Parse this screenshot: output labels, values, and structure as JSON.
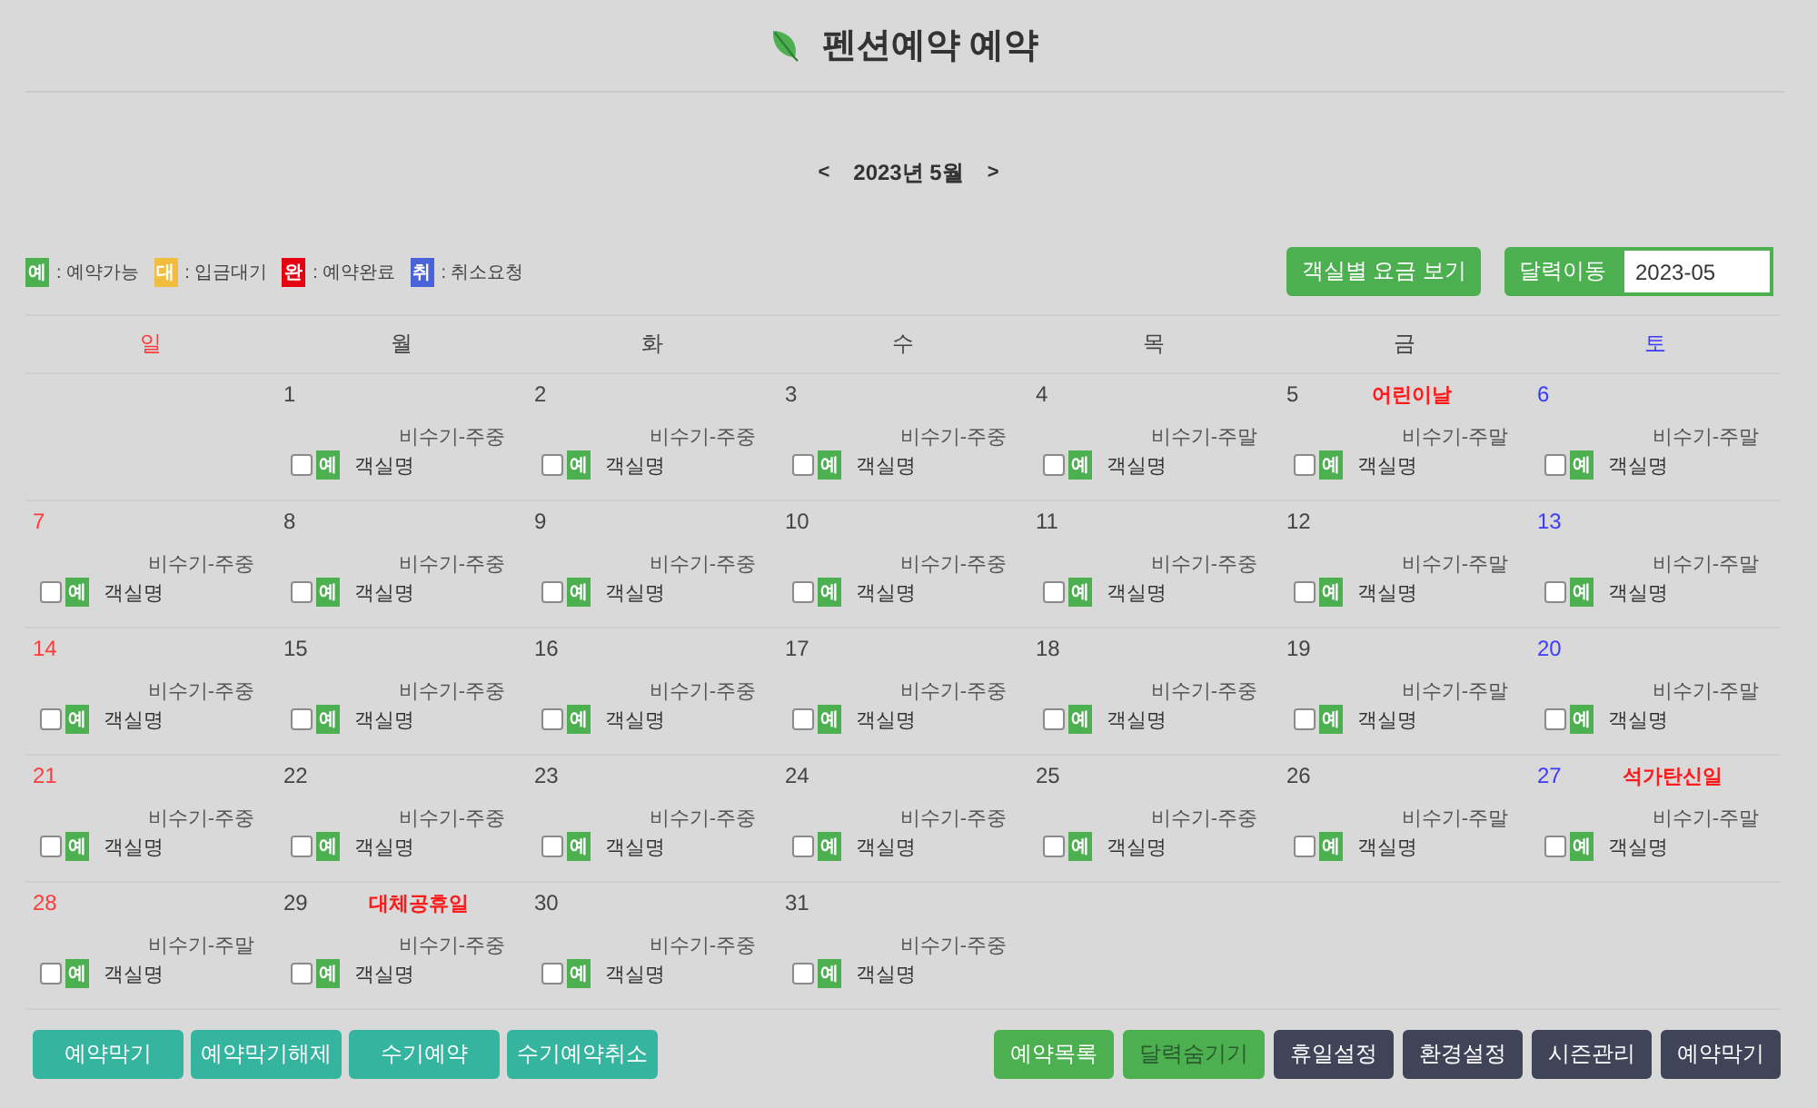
{
  "header": {
    "title": "펜션예약 예약"
  },
  "month_nav": {
    "prev": "<",
    "label": "2023년 5월",
    "next": ">"
  },
  "legend": [
    {
      "badge": "예",
      "label": ": 예약가능",
      "color": "#4caf50"
    },
    {
      "badge": "대",
      "label": ": 입금대기",
      "color": "#f0bd3f"
    },
    {
      "badge": "완",
      "label": ": 예약완료",
      "color": "#e60012"
    },
    {
      "badge": "취",
      "label": ": 취소요청",
      "color": "#4a63d8"
    }
  ],
  "toolbar": {
    "rate_button": "객실별 요금 보기",
    "date_jump": {
      "button": "달력이동",
      "value": "2023-05"
    }
  },
  "calendar": {
    "weekdays": [
      {
        "label": "일",
        "kind": "sunday"
      },
      {
        "label": "월",
        "kind": "weekday"
      },
      {
        "label": "화",
        "kind": "weekday"
      },
      {
        "label": "수",
        "kind": "weekday"
      },
      {
        "label": "목",
        "kind": "weekday"
      },
      {
        "label": "금",
        "kind": "weekday"
      },
      {
        "label": "토",
        "kind": "saturday"
      }
    ],
    "weeks": [
      [
        {
          "kind": "blank"
        },
        {
          "kind": "weekday",
          "date": "1",
          "season": "비수기-주중",
          "rooms": [
            {
              "checked": false,
              "badge": "예",
              "color": "#4caf50",
              "name": "객실명"
            }
          ]
        },
        {
          "kind": "weekday",
          "date": "2",
          "season": "비수기-주중",
          "rooms": [
            {
              "checked": false,
              "badge": "예",
              "color": "#4caf50",
              "name": "객실명"
            }
          ]
        },
        {
          "kind": "weekday",
          "date": "3",
          "season": "비수기-주중",
          "rooms": [
            {
              "checked": false,
              "badge": "예",
              "color": "#4caf50",
              "name": "객실명"
            }
          ]
        },
        {
          "kind": "weekday",
          "date": "4",
          "season": "비수기-주말",
          "rooms": [
            {
              "checked": false,
              "badge": "예",
              "color": "#4caf50",
              "name": "객실명"
            }
          ]
        },
        {
          "kind": "weekday",
          "date": "5",
          "holiday": "어린이날",
          "season": "비수기-주말",
          "rooms": [
            {
              "checked": false,
              "badge": "예",
              "color": "#4caf50",
              "name": "객실명"
            }
          ]
        },
        {
          "kind": "saturday",
          "date": "6",
          "season": "비수기-주말",
          "rooms": [
            {
              "checked": false,
              "badge": "예",
              "color": "#4caf50",
              "name": "객실명"
            }
          ]
        }
      ],
      [
        {
          "kind": "sunday",
          "date": "7",
          "season": "비수기-주중",
          "rooms": [
            {
              "checked": false,
              "badge": "예",
              "color": "#4caf50",
              "name": "객실명"
            }
          ]
        },
        {
          "kind": "weekday",
          "date": "8",
          "season": "비수기-주중",
          "rooms": [
            {
              "checked": false,
              "badge": "예",
              "color": "#4caf50",
              "name": "객실명"
            }
          ]
        },
        {
          "kind": "weekday",
          "date": "9",
          "season": "비수기-주중",
          "rooms": [
            {
              "checked": false,
              "badge": "예",
              "color": "#4caf50",
              "name": "객실명"
            }
          ]
        },
        {
          "kind": "weekday",
          "date": "10",
          "season": "비수기-주중",
          "rooms": [
            {
              "checked": false,
              "badge": "예",
              "color": "#4caf50",
              "name": "객실명"
            }
          ]
        },
        {
          "kind": "weekday",
          "date": "11",
          "season": "비수기-주중",
          "rooms": [
            {
              "checked": false,
              "badge": "예",
              "color": "#4caf50",
              "name": "객실명"
            }
          ]
        },
        {
          "kind": "weekday",
          "date": "12",
          "season": "비수기-주말",
          "rooms": [
            {
              "checked": false,
              "badge": "예",
              "color": "#4caf50",
              "name": "객실명"
            }
          ]
        },
        {
          "kind": "saturday",
          "date": "13",
          "season": "비수기-주말",
          "rooms": [
            {
              "checked": false,
              "badge": "예",
              "color": "#4caf50",
              "name": "객실명"
            }
          ]
        }
      ],
      [
        {
          "kind": "sunday",
          "date": "14",
          "season": "비수기-주중",
          "rooms": [
            {
              "checked": false,
              "badge": "예",
              "color": "#4caf50",
              "name": "객실명"
            }
          ]
        },
        {
          "kind": "weekday",
          "date": "15",
          "season": "비수기-주중",
          "rooms": [
            {
              "checked": false,
              "badge": "예",
              "color": "#4caf50",
              "name": "객실명"
            }
          ]
        },
        {
          "kind": "weekday",
          "date": "16",
          "season": "비수기-주중",
          "rooms": [
            {
              "checked": false,
              "badge": "예",
              "color": "#4caf50",
              "name": "객실명"
            }
          ]
        },
        {
          "kind": "weekday",
          "date": "17",
          "season": "비수기-주중",
          "rooms": [
            {
              "checked": false,
              "badge": "예",
              "color": "#4caf50",
              "name": "객실명"
            }
          ]
        },
        {
          "kind": "weekday",
          "date": "18",
          "season": "비수기-주중",
          "rooms": [
            {
              "checked": false,
              "badge": "예",
              "color": "#4caf50",
              "name": "객실명"
            }
          ]
        },
        {
          "kind": "weekday",
          "date": "19",
          "season": "비수기-주말",
          "rooms": [
            {
              "checked": false,
              "badge": "예",
              "color": "#4caf50",
              "name": "객실명"
            }
          ]
        },
        {
          "kind": "saturday",
          "date": "20",
          "season": "비수기-주말",
          "rooms": [
            {
              "checked": false,
              "badge": "예",
              "color": "#4caf50",
              "name": "객실명"
            }
          ]
        }
      ],
      [
        {
          "kind": "sunday",
          "date": "21",
          "season": "비수기-주중",
          "rooms": [
            {
              "checked": false,
              "badge": "예",
              "color": "#4caf50",
              "name": "객실명"
            }
          ]
        },
        {
          "kind": "weekday",
          "date": "22",
          "season": "비수기-주중",
          "rooms": [
            {
              "checked": false,
              "badge": "예",
              "color": "#4caf50",
              "name": "객실명"
            }
          ]
        },
        {
          "kind": "weekday",
          "date": "23",
          "season": "비수기-주중",
          "rooms": [
            {
              "checked": false,
              "badge": "예",
              "color": "#4caf50",
              "name": "객실명"
            }
          ]
        },
        {
          "kind": "weekday",
          "date": "24",
          "season": "비수기-주중",
          "rooms": [
            {
              "checked": false,
              "badge": "예",
              "color": "#4caf50",
              "name": "객실명"
            }
          ]
        },
        {
          "kind": "weekday",
          "date": "25",
          "season": "비수기-주중",
          "rooms": [
            {
              "checked": false,
              "badge": "예",
              "color": "#4caf50",
              "name": "객실명"
            }
          ]
        },
        {
          "kind": "weekday",
          "date": "26",
          "season": "비수기-주말",
          "rooms": [
            {
              "checked": false,
              "badge": "예",
              "color": "#4caf50",
              "name": "객실명"
            }
          ]
        },
        {
          "kind": "saturday",
          "date": "27",
          "holiday": "석가탄신일",
          "season": "비수기-주말",
          "rooms": [
            {
              "checked": false,
              "badge": "예",
              "color": "#4caf50",
              "name": "객실명"
            }
          ]
        }
      ],
      [
        {
          "kind": "sunday",
          "date": "28",
          "season": "비수기-주말",
          "rooms": [
            {
              "checked": false,
              "badge": "예",
              "color": "#4caf50",
              "name": "객실명"
            }
          ]
        },
        {
          "kind": "weekday",
          "date": "29",
          "holiday": "대체공휴일",
          "season": "비수기-주중",
          "rooms": [
            {
              "checked": false,
              "badge": "예",
              "color": "#4caf50",
              "name": "객실명"
            }
          ]
        },
        {
          "kind": "weekday",
          "date": "30",
          "season": "비수기-주중",
          "rooms": [
            {
              "checked": false,
              "badge": "예",
              "color": "#4caf50",
              "name": "객실명"
            }
          ]
        },
        {
          "kind": "weekday",
          "date": "31",
          "season": "비수기-주중",
          "rooms": [
            {
              "checked": false,
              "badge": "예",
              "color": "#4caf50",
              "name": "객실명"
            }
          ]
        },
        {
          "kind": "blank"
        },
        {
          "kind": "blank"
        },
        {
          "kind": "blank"
        }
      ]
    ]
  },
  "left_buttons": [
    "예약막기",
    "예약막기해제",
    "수기예약",
    "수기예약취소"
  ],
  "right_buttons": [
    {
      "label": "예약목록",
      "color": "#4caf50",
      "active": false
    },
    {
      "label": "달력숨기기",
      "color": "#4caf50",
      "active": true
    },
    {
      "label": "휴일설정",
      "color": "#3f4459",
      "active": false
    },
    {
      "label": "환경설정",
      "color": "#3f4459",
      "active": false
    },
    {
      "label": "시즌관리",
      "color": "#3f4459",
      "active": false
    },
    {
      "label": "예약막기",
      "color": "#3f4459",
      "active": false
    }
  ]
}
